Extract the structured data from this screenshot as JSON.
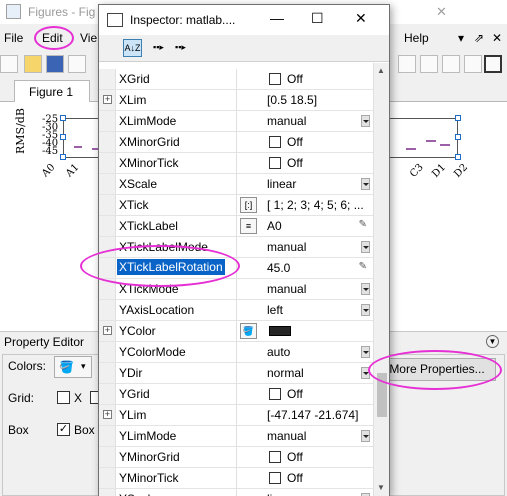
{
  "figures_window": {
    "title": "Figures - Fig",
    "menu": [
      {
        "label": "File",
        "underline": "F"
      },
      {
        "label": "Edit",
        "underline": "E"
      },
      {
        "label": "Vie",
        "underline": "V"
      },
      {
        "label": "Help",
        "underline": "H"
      }
    ],
    "dock_glyph": "▾",
    "undock_glyph": "⇗",
    "close_glyph": "✕",
    "tab_label": "Figure 1",
    "axes": {
      "ylabel": "RMS/dB",
      "yticks": [
        "-25",
        "-30",
        "-35",
        "-40",
        "-45"
      ],
      "xticks_left": [
        "A0",
        "A1"
      ],
      "xticks_right": [
        "C3",
        "D1",
        "D2"
      ]
    }
  },
  "property_editor": {
    "title": "Property Editor",
    "colors_label": "Colors:",
    "grid_label": "Grid:",
    "grid_x_label": "X",
    "box_label": "Box",
    "box_checkbox_label": "Box",
    "more_properties_label": "More Properties..."
  },
  "inspector": {
    "title": "Inspector:  matlab....",
    "minimize_glyph": "—",
    "maximize_glyph": "☐",
    "close_glyph": "✕",
    "properties": [
      {
        "name": "XGrid",
        "type": "check",
        "value": "Off",
        "checked": false
      },
      {
        "name": "XLim",
        "type": "text",
        "value": "[0.5 18.5]",
        "expandable": true
      },
      {
        "name": "XLimMode",
        "type": "dropdown",
        "value": "manual"
      },
      {
        "name": "XMinorGrid",
        "type": "check",
        "value": "Off",
        "checked": false
      },
      {
        "name": "XMinorTick",
        "type": "check",
        "value": "Off",
        "checked": false
      },
      {
        "name": "XScale",
        "type": "dropdown",
        "value": "linear"
      },
      {
        "name": "XTick",
        "type": "array",
        "value": "[ 1; 2; 3; 4; 5; 6; ...",
        "icon": "[:]"
      },
      {
        "name": "XTickLabel",
        "type": "list",
        "value": "A0",
        "icon": "≡",
        "pencil": true
      },
      {
        "name": "XTickLabelMode",
        "type": "dropdown",
        "value": "manual"
      },
      {
        "name": "XTickLabelRotation",
        "type": "text",
        "value": "45.0",
        "pencil": true,
        "selected": true
      },
      {
        "name": "XTickMode",
        "type": "dropdown",
        "value": "manual"
      },
      {
        "name": "YAxisLocation",
        "type": "dropdown",
        "value": "left"
      },
      {
        "name": "YColor",
        "type": "color",
        "value": "#262626",
        "expandable": true,
        "icon": "paint-bucket"
      },
      {
        "name": "YColorMode",
        "type": "dropdown",
        "value": "auto"
      },
      {
        "name": "YDir",
        "type": "dropdown",
        "value": "normal"
      },
      {
        "name": "YGrid",
        "type": "check",
        "value": "Off",
        "checked": false
      },
      {
        "name": "YLim",
        "type": "text",
        "value": "[-47.147 -21.674]",
        "expandable": true
      },
      {
        "name": "YLimMode",
        "type": "dropdown",
        "value": "manual"
      },
      {
        "name": "YMinorGrid",
        "type": "check",
        "value": "Off",
        "checked": false
      },
      {
        "name": "YMinorTick",
        "type": "check",
        "value": "Off",
        "checked": false
      },
      {
        "name": "YScale",
        "type": "dropdown",
        "value": "linear"
      }
    ]
  },
  "colors": {
    "highlight": "#e62fd4",
    "selection": "#0a64c8",
    "box_plot": "#7a2a8a"
  }
}
